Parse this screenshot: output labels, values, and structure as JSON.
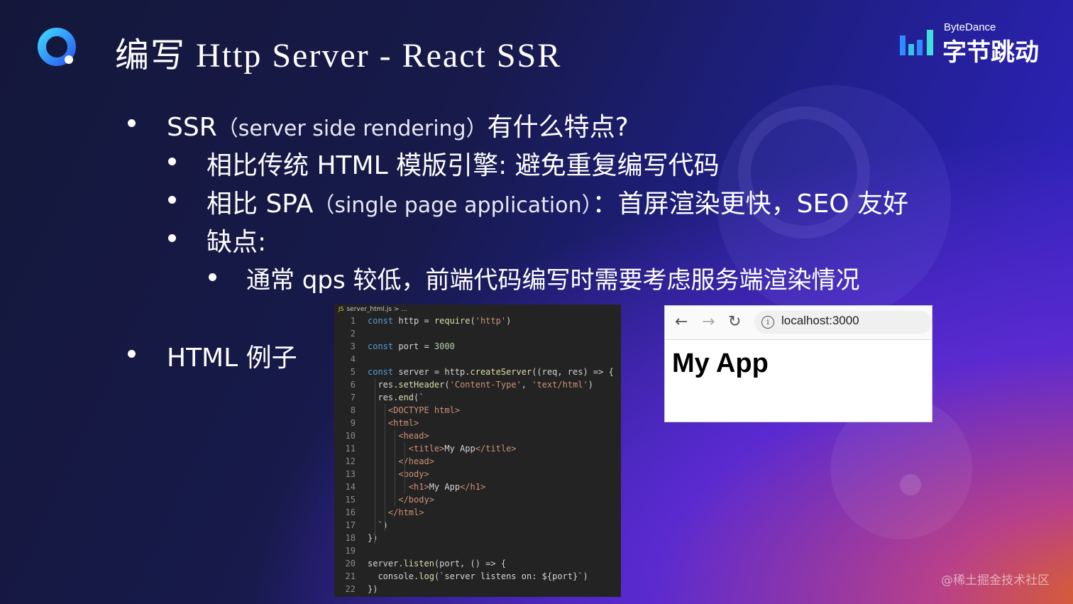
{
  "title": "编写 Http Server -  React SSR",
  "brand": {
    "en": "ByteDance",
    "cn": "字节跳动"
  },
  "bullets": [
    {
      "main": "SSR",
      "aside": "（server side rendering）",
      "tail": "有什么特点?"
    },
    {
      "main": "相比传统 HTML 模版引擎: 避免重复编写代码"
    },
    {
      "main": "相比 SPA",
      "aside": "（single page application）",
      "tail": "：首屏渲染更快，SEO 友好"
    },
    {
      "main": "缺点:"
    },
    {
      "main": "通常 qps 较低，前端代码编写时需要考虑服务端渲染情况"
    },
    {
      "main": "HTML 例子"
    }
  ],
  "code": {
    "breadcrumb": "server_html.js > ...",
    "lines": [
      {
        "n": "1",
        "t": "const http = require('http')"
      },
      {
        "n": "2",
        "t": ""
      },
      {
        "n": "3",
        "t": "const port = 3000"
      },
      {
        "n": "4",
        "t": ""
      },
      {
        "n": "5",
        "t": "const server = http.createServer((req, res) => {"
      },
      {
        "n": "6",
        "t": "  res.setHeader('Content-Type', 'text/html')"
      },
      {
        "n": "7",
        "t": "  res.end(`"
      },
      {
        "n": "8",
        "t": "    <DOCTYPE html>"
      },
      {
        "n": "9",
        "t": "    <html>"
      },
      {
        "n": "10",
        "t": "      <head>"
      },
      {
        "n": "11",
        "t": "        <title>My App</title>"
      },
      {
        "n": "12",
        "t": "      </head>"
      },
      {
        "n": "13",
        "t": "      <body>"
      },
      {
        "n": "14",
        "t": "        <h1>My App</h1>"
      },
      {
        "n": "15",
        "t": "      </body>"
      },
      {
        "n": "16",
        "t": "    </html>"
      },
      {
        "n": "17",
        "t": "  `)"
      },
      {
        "n": "18",
        "t": "})"
      },
      {
        "n": "19",
        "t": ""
      },
      {
        "n": "20",
        "t": "server.listen(port, () => {"
      },
      {
        "n": "21",
        "t": "  console.log(`server listens on: ${port}`)"
      },
      {
        "n": "22",
        "t": "})"
      }
    ]
  },
  "browser": {
    "url": "localhost:3000",
    "heading": "My App"
  },
  "footer": "@稀土掘金技术社区",
  "colors": {
    "bar_blue": "#3aa0ff",
    "bar_cyan": "#35d0e0",
    "logo_q": "#2f7cf6"
  }
}
